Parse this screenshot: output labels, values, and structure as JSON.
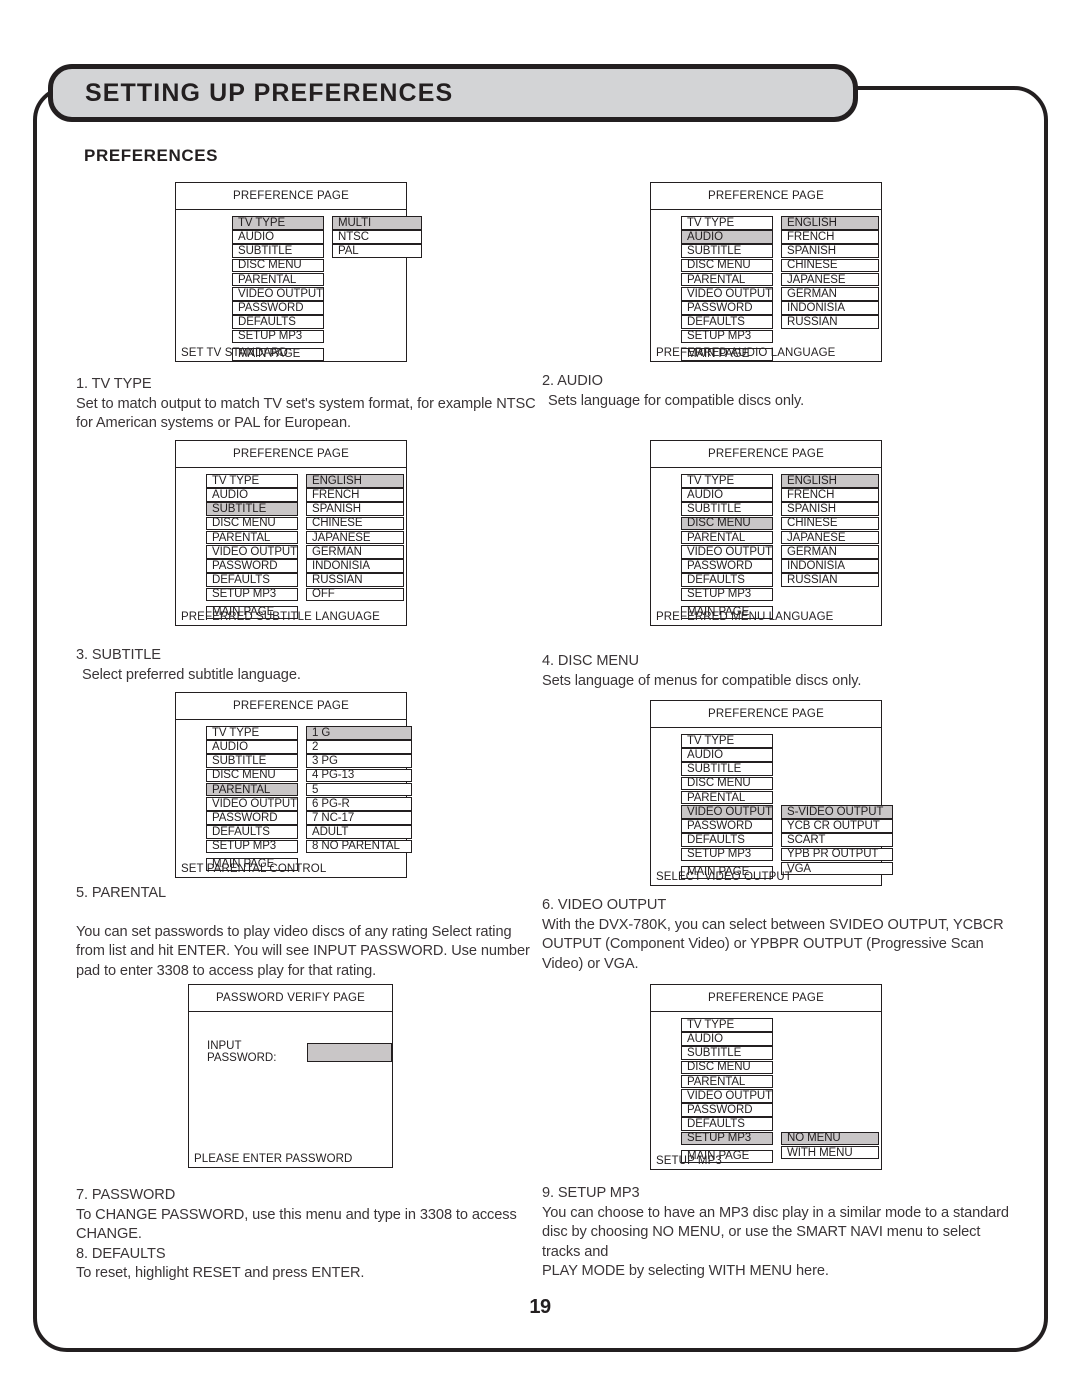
{
  "banner": {
    "title": "SETTING UP PREFERENCES"
  },
  "section_heading": "PREFERENCES",
  "page_number": "19",
  "colors": {
    "highlight": "#c9c6c7",
    "banner_bg": "#d3d4d6",
    "ink": "#231f20"
  },
  "menu_labels": {
    "tv_type": "TV TYPE",
    "audio": "AUDIO",
    "subtitle": "SUBTITLE",
    "disc_menu": "DISC MENU",
    "parental": "PARENTAL",
    "video_output": "VIDEO OUTPUT",
    "password": "PASSWORD",
    "defaults": "DEFAULTS",
    "setup_mp3": "SETUP MP3",
    "main_page": "MAIN PAGE"
  },
  "diagrams": [
    {
      "id": "tv-type",
      "title": "PREFERENCE PAGE",
      "footer": "SET TV STANDARD",
      "left_items": [
        "TV TYPE",
        "AUDIO",
        "SUBTITLE",
        "DISC MENU",
        "PARENTAL",
        "VIDEO OUTPUT",
        "PASSWORD",
        "DEFAULTS",
        "SETUP MP3"
      ],
      "left_highlight": "TV TYPE",
      "main_page": "MAIN PAGE",
      "right_items": [
        "MULTI",
        "NTSC",
        "PAL"
      ],
      "right_highlight": "MULTI",
      "right_offset_rows": 0
    },
    {
      "id": "audio",
      "title": "PREFERENCE PAGE",
      "footer": "PREFERRED AUDIO LANGUAGE",
      "left_items": [
        "TV TYPE",
        "AUDIO",
        "SUBTITLE",
        "DISC MENU",
        "PARENTAL",
        "VIDEO OUTPUT",
        "PASSWORD",
        "DEFAULTS",
        "SETUP MP3"
      ],
      "left_highlight": "AUDIO",
      "main_page": "MAIN PAGE",
      "right_items": [
        "ENGLISH",
        "FRENCH",
        "SPANISH",
        "CHINESE",
        "JAPANESE",
        "GERMAN",
        "INDONISIA",
        "RUSSIAN"
      ],
      "right_highlight": "ENGLISH",
      "right_offset_rows": 0
    },
    {
      "id": "subtitle",
      "title": "PREFERENCE PAGE",
      "footer": "PREFERRED SUBTITLE LANGUAGE",
      "left_items": [
        "TV TYPE",
        "AUDIO",
        "SUBTITLE",
        "DISC MENU",
        "PARENTAL",
        "VIDEO OUTPUT",
        "PASSWORD",
        "DEFAULTS",
        "SETUP MP3"
      ],
      "left_highlight": "SUBTITLE",
      "main_page": "MAIN PAGE",
      "right_items": [
        "ENGLISH",
        "FRENCH",
        "SPANISH",
        "CHINESE",
        "JAPANESE",
        "GERMAN",
        "INDONISIA",
        "RUSSIAN",
        "OFF"
      ],
      "right_highlight": "ENGLISH",
      "right_offset_rows": 0
    },
    {
      "id": "disc-menu",
      "title": "PREFERENCE PAGE",
      "footer": "PREFERRED MENU LANGUAGE",
      "left_items": [
        "TV TYPE",
        "AUDIO",
        "SUBTITLE",
        "DISC MENU",
        "PARENTAL",
        "VIDEO OUTPUT",
        "PASSWORD",
        "DEFAULTS",
        "SETUP MP3"
      ],
      "left_highlight": "DISC MENU",
      "main_page": "MAIN PAGE",
      "right_items": [
        "ENGLISH",
        "FRENCH",
        "SPANISH",
        "CHINESE",
        "JAPANESE",
        "GERMAN",
        "INDONISIA",
        "RUSSIAN"
      ],
      "right_highlight": "ENGLISH",
      "right_offset_rows": 0
    },
    {
      "id": "parental",
      "title": "PREFERENCE PAGE",
      "footer": "SET PARENTAL CONTROL",
      "left_items": [
        "TV TYPE",
        "AUDIO",
        "SUBTITLE",
        "DISC MENU",
        "PARENTAL",
        "VIDEO OUTPUT",
        "PASSWORD",
        "DEFAULTS",
        "SETUP MP3"
      ],
      "left_highlight": "PARENTAL",
      "main_page": "MAIN PAGE",
      "right_items": [
        "1 G",
        "2",
        "3 PG",
        "4 PG-13",
        "5",
        "6 PG-R",
        "7 NC-17",
        "ADULT",
        "8 NO PARENTAL"
      ],
      "right_highlight": "1 G",
      "right_offset_rows": 0
    },
    {
      "id": "video-output",
      "title": "PREFERENCE PAGE",
      "footer": "SELECT VIDEO OUTPUT",
      "left_items": [
        "TV TYPE",
        "AUDIO",
        "SUBTITLE",
        "DISC MENU",
        "PARENTAL",
        "VIDEO OUTPUT",
        "PASSWORD",
        "DEFAULTS",
        "SETUP MP3"
      ],
      "left_highlight": "VIDEO OUTPUT",
      "main_page": "MAIN PAGE",
      "right_items": [
        "S-VIDEO OUTPUT",
        "YCB CR OUTPUT",
        "SCART",
        "YPB PR OUTPUT",
        "VGA"
      ],
      "right_highlight": "S-VIDEO OUTPUT",
      "right_offset_rows": 5
    },
    {
      "id": "setup-mp3",
      "title": "PREFERENCE PAGE",
      "footer": "SETUP MP3",
      "left_items": [
        "TV TYPE",
        "AUDIO",
        "SUBTITLE",
        "DISC MENU",
        "PARENTAL",
        "VIDEO OUTPUT",
        "PASSWORD",
        "DEFAULTS",
        "SETUP MP3"
      ],
      "left_highlight": "SETUP MP3",
      "main_page": "MAIN PAGE",
      "right_items": [
        "NO MENU",
        "WITH MENU"
      ],
      "right_highlight": "NO MENU",
      "right_offset_rows": 8
    }
  ],
  "password_page": {
    "title": "PASSWORD VERIFY PAGE",
    "label": "INPUT PASSWORD:",
    "value": "",
    "footer": "PLEASE ENTER PASSWORD"
  },
  "copy": {
    "item1": {
      "heading": "1. TV TYPE",
      "body": "Set to match output to match TV set's system format, for example NTSC for American systems or  PAL for European."
    },
    "item2": {
      "heading": "2. AUDIO",
      "body": "Sets language for compatible discs only."
    },
    "item3": {
      "heading": "3. SUBTITLE",
      "body": "Select preferred subtitle language."
    },
    "item4": {
      "heading": "4. DISC MENU",
      "body": "Sets language of menus for compatible discs only."
    },
    "item5": {
      "heading": "5. PARENTAL",
      "body": "You can set passwords to play video discs of any rating  Select rating from list and hit ENTER.  You will see INPUT PASSWORD.  Use number pad to enter 3308 to access play for that rating."
    },
    "item6": {
      "heading": "6. VIDEO OUTPUT",
      "body": "With the DVX-780K, you can select between SVIDEO OUTPUT, YCBCR OUTPUT (Component Video) or YPBPR OUTPUT (Progressive Scan Video) or VGA."
    },
    "item7": {
      "heading": "7. PASSWORD",
      "body": "To CHANGE PASSWORD, use this menu and type in 3308 to access CHANGE."
    },
    "item8": {
      "heading": "8. DEFAULTS",
      "body": "To reset, highlight RESET and press ENTER."
    },
    "item9": {
      "heading": "9. SETUP MP3",
      "body": "You can choose to have an MP3 disc play in a similar mode to a standard disc by choosing NO MENU, or use the SMART NAVI menu to select tracks and",
      "body2": "PLAY MODE by selecting WITH MENU here."
    }
  }
}
